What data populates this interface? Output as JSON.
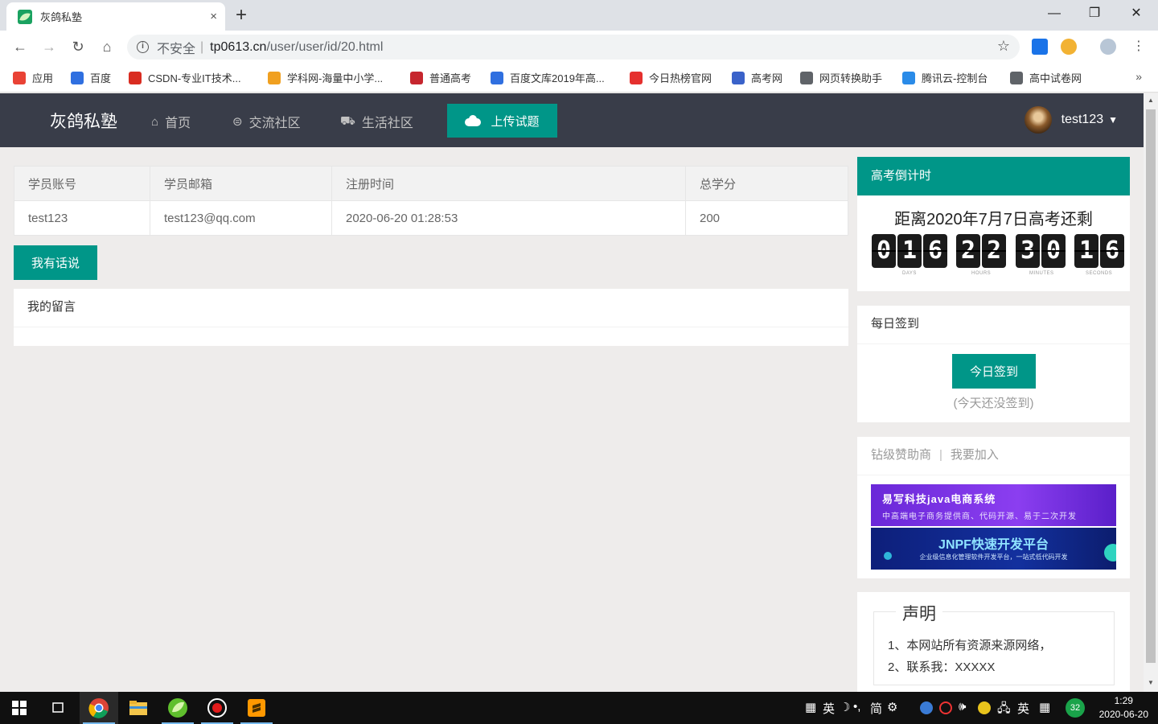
{
  "browser": {
    "tab_title": "灰鸽私塾",
    "tab_close": "×",
    "new_tab": "+",
    "win_minimize": "—",
    "win_restore": "❐",
    "win_close": "✕",
    "security_label": "不安全",
    "separator": "|",
    "url_host": "tp0613.cn",
    "url_path": "/user/user/id/20.html",
    "bookmarks": [
      {
        "label": "应用",
        "icon": "apps-grid-icon",
        "color": "#e94235"
      },
      {
        "label": "百度",
        "icon": "baidu-paw-icon",
        "color": "#2f6fe0"
      },
      {
        "label": "CSDN-专业IT技术...",
        "icon": "csdn-icon",
        "color": "#d92c21"
      },
      {
        "label": "学科网-海量中小学...",
        "icon": "xueke-icon",
        "color": "#f0a020"
      },
      {
        "label": "普通高考",
        "icon": "gaokao-icon",
        "color": "#c6262e"
      },
      {
        "label": "百度文库2019年高...",
        "icon": "baidu-paw-icon",
        "color": "#2f6fe0"
      },
      {
        "label": "今日热榜官网",
        "icon": "rebang-icon",
        "color": "#e5302e"
      },
      {
        "label": "高考网",
        "icon": "gaokaowang-icon",
        "color": "#3a62c9"
      },
      {
        "label": "网页转换助手",
        "icon": "globe-icon",
        "color": "#5f6368"
      },
      {
        "label": "腾讯云-控制台",
        "icon": "tencent-cloud-icon",
        "color": "#2a8be8"
      },
      {
        "label": "高中试卷网",
        "icon": "globe-icon",
        "color": "#5f6368"
      }
    ],
    "bookmarks_more": "»"
  },
  "site": {
    "logo": "灰鸽私塾",
    "nav": [
      {
        "label": "首页",
        "icon": "home-icon",
        "glyph": "⌂"
      },
      {
        "label": "交流社区",
        "icon": "chat-icon",
        "glyph": "⊜"
      },
      {
        "label": "生活社区",
        "icon": "cart-icon",
        "glyph": "🛒"
      }
    ],
    "upload_label": "上传试题",
    "username": "test123",
    "caret": "▼"
  },
  "profile": {
    "headers": [
      "学员账号",
      "学员邮箱",
      "注册时间",
      "总学分"
    ],
    "row": [
      "test123",
      "test123@qq.com",
      "2020-06-20 01:28:53",
      "200"
    ]
  },
  "speak_label": "我有话说",
  "messages_title": "我的留言",
  "countdown": {
    "title": "高考倒计时",
    "text": "距离2020年7月7日高考还剩",
    "digits": [
      "0",
      "1",
      "6",
      "2",
      "2",
      "3",
      "0",
      "1",
      "6"
    ],
    "units": [
      "DAYS",
      "HOURS",
      "MINUTES",
      "SECONDS"
    ]
  },
  "signin": {
    "title": "每日签到",
    "button": "今日签到",
    "note": "(今天还没签到)"
  },
  "sponsor": {
    "title": "钻级赞助商",
    "pipe": "|",
    "join": "我要加入",
    "banner1_title": "易写科技java电商系统",
    "banner1_sub": "中高端电子商务提供商、代码开源、易于二次开发",
    "banner2_title": "JNPF快速开发平台",
    "banner2_sub": "企业级信息化管理软件开发平台，一站式低代码开发"
  },
  "notice": {
    "title": "声明",
    "lines": [
      "1、本网站所有资源来源网络，",
      "2、联系我：XXXXX"
    ]
  },
  "taskbar": {
    "ime_items": [
      "英",
      "简"
    ],
    "tray_lang": "英",
    "badge": "32",
    "time": "1:29",
    "date": "2020-06-20"
  },
  "colors": {
    "accent": "#009688",
    "header_bg": "#393d49",
    "page_bg": "#eeeceb"
  }
}
